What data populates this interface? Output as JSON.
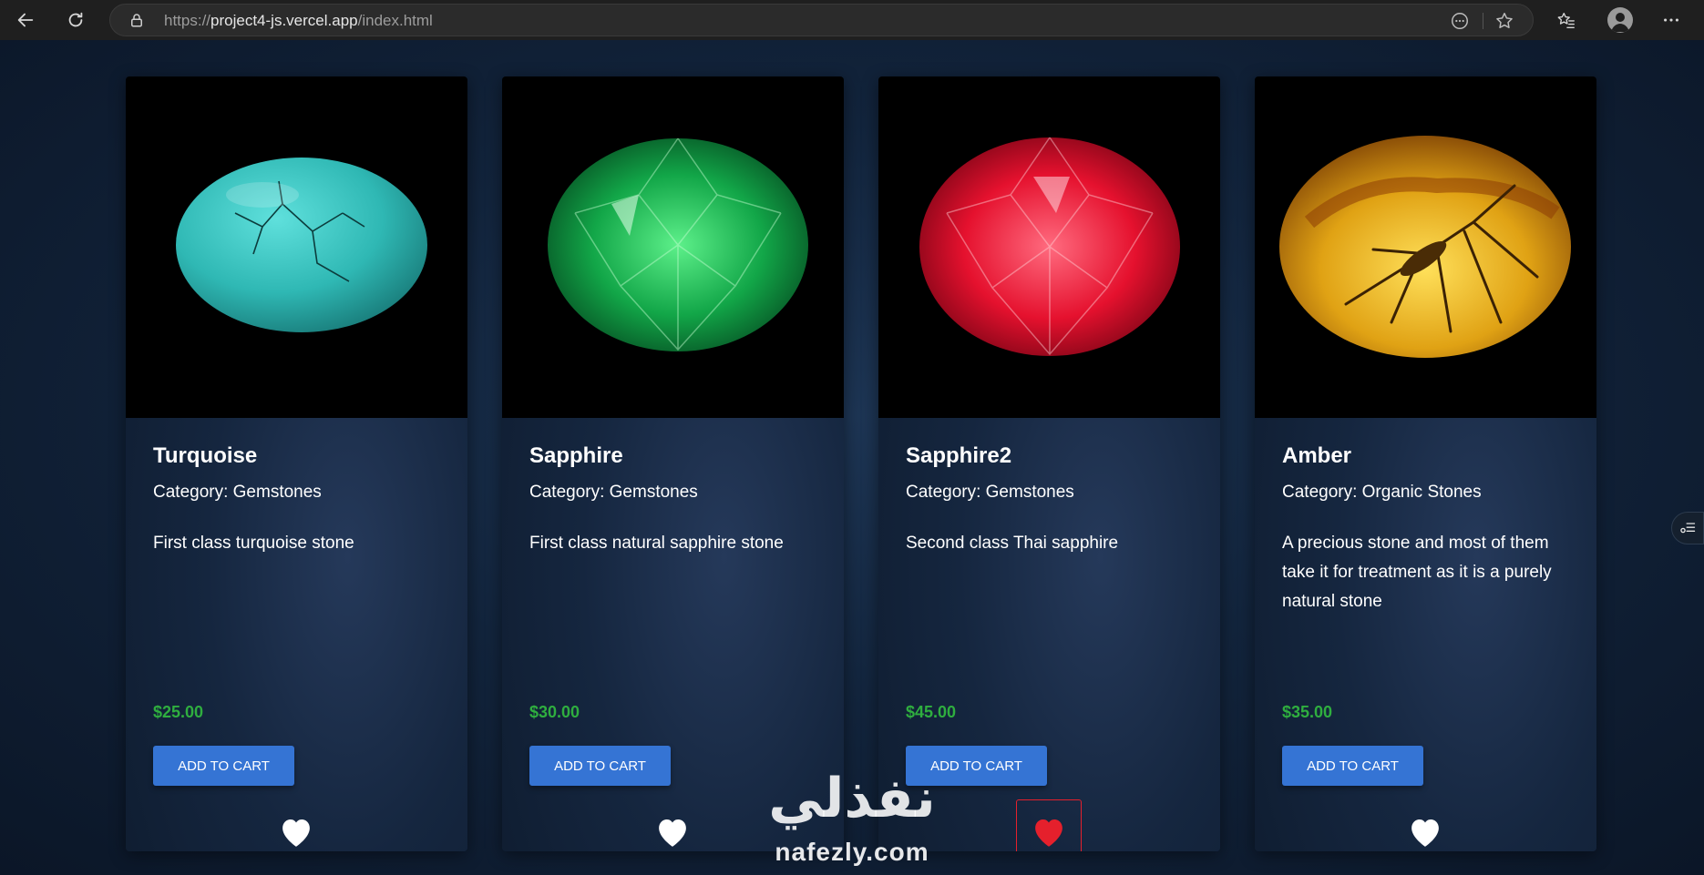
{
  "browser": {
    "url_prefix": "https://",
    "url_host": "project4-js.vercel.app",
    "url_path": "/index.html"
  },
  "products": [
    {
      "name": "Turquoise",
      "category": "Category: Gemstones",
      "description": "First class turquoise stone",
      "price": "$25.00",
      "button": "ADD TO CART",
      "favorite": false,
      "image_icon": "turquoise-stone"
    },
    {
      "name": "Sapphire",
      "category": "Category: Gemstones",
      "description": "First class natural sapphire stone",
      "price": "$30.00",
      "button": "ADD TO CART",
      "favorite": false,
      "image_icon": "green-sapphire-gem"
    },
    {
      "name": "Sapphire2",
      "category": "Category: Gemstones",
      "description": "Second class Thai sapphire",
      "price": "$45.00",
      "button": "ADD TO CART",
      "favorite": true,
      "image_icon": "red-sapphire-gem"
    },
    {
      "name": "Amber",
      "category": "Category: Organic Stones",
      "description": "A precious stone and most of them take it for treatment as it is a purely natural stone",
      "price": "$35.00",
      "button": "ADD TO CART",
      "favorite": false,
      "image_icon": "amber-stone"
    }
  ],
  "watermark": {
    "arabic": "نفذلي",
    "latin": "nafezly.com"
  },
  "colors": {
    "button": "#3574d4",
    "price": "#2fae3f",
    "heart_active": "#e5202c",
    "heart_inactive": "#ffffff"
  }
}
